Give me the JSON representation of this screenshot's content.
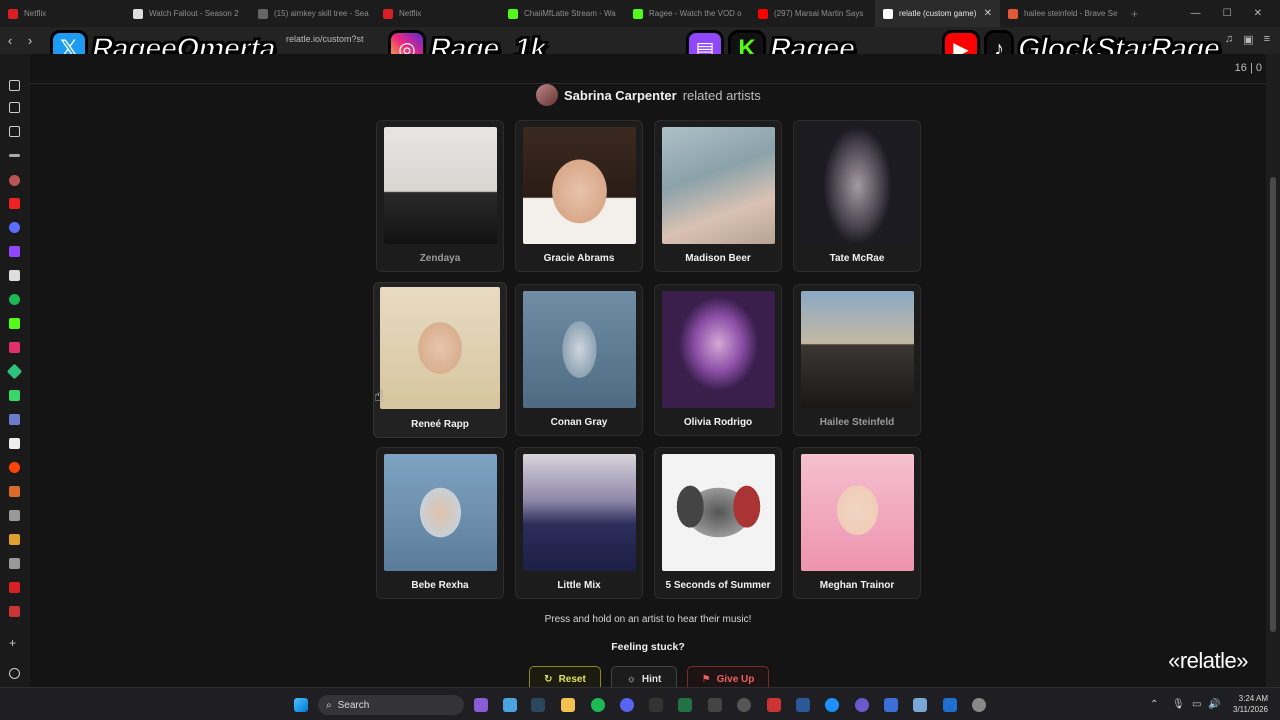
{
  "browser": {
    "tabs": [
      {
        "title": "Netflix",
        "fav_color": "#d81f26"
      },
      {
        "title": "Watch Fallout - Season 2",
        "fav_color": "#e6e6e6"
      },
      {
        "title": "(15) aimkey skill tree - Sea",
        "fav_color": "#e6e6e6"
      },
      {
        "title": "Netflix",
        "fav_color": "#d81f26"
      },
      {
        "title": "ChaiiMfLatte Stream - Wa",
        "fav_color": "#53fc18"
      },
      {
        "title": "Ragee - Watch the VOD o",
        "fav_color": "#53fc18"
      },
      {
        "title": "(297) Marsai Martin Says",
        "fav_color": "#ff0000"
      },
      {
        "title": "relatle (custom game)",
        "fav_color": "#ffffff"
      },
      {
        "title": "hailee steinfeld - Brave Se",
        "fav_color": "#e05a36"
      }
    ],
    "url": "relatle.io/custom?st"
  },
  "overlay": {
    "twitter_handle": "RageeOmerta",
    "instagram_handle": "Rage_1k",
    "twitch_kick_handle": "Ragee",
    "youtube_tiktok_handle": "GlockStarRage"
  },
  "page": {
    "score": "16 | 0",
    "title_artist": "Sabrina Carpenter",
    "title_suffix": "related artists",
    "artists": [
      {
        "name": "Zendaya",
        "muted": true
      },
      {
        "name": "Gracie Abrams",
        "muted": false
      },
      {
        "name": "Madison Beer",
        "muted": false
      },
      {
        "name": "Tate McRae",
        "muted": false
      },
      {
        "name": "Reneé Rapp",
        "muted": false
      },
      {
        "name": "Conan Gray",
        "muted": false
      },
      {
        "name": "Olivia Rodrigo",
        "muted": false
      },
      {
        "name": "Hailee Steinfeld",
        "muted": true
      },
      {
        "name": "Bebe Rexha",
        "muted": false
      },
      {
        "name": "Little Mix",
        "muted": false
      },
      {
        "name": "5 Seconds of Summer",
        "muted": false
      },
      {
        "name": "Meghan Trainor",
        "muted": false
      }
    ],
    "instruction": "Press and hold on an artist to hear their music!",
    "stuck": "Feeling stuck?",
    "buttons": {
      "reset": "Reset",
      "hint": "Hint",
      "give_up": "Give Up"
    },
    "logo": "«relatle»"
  },
  "taskbar": {
    "search_placeholder": "Search",
    "time": "3:24 AM",
    "date": "3/11/2026"
  }
}
